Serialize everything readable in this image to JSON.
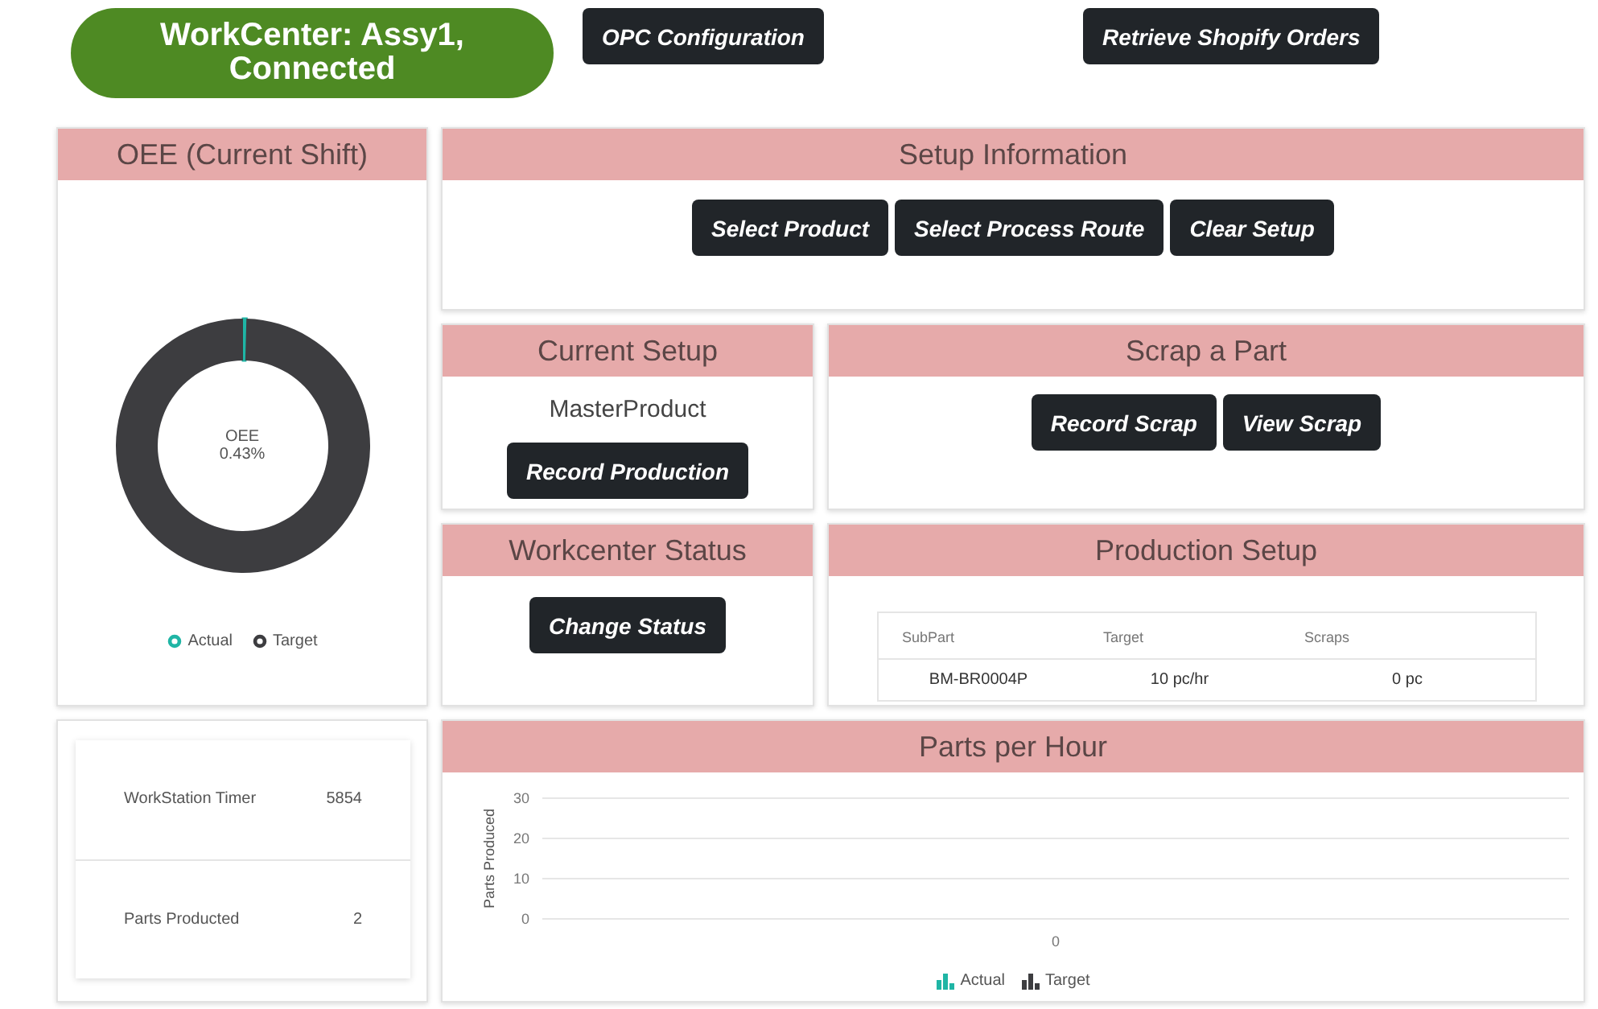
{
  "top_bar": {
    "workcenter_status": "WorkCenter: Assy1, Connected",
    "buttons": [
      "OPC Configuration",
      "Retrieve Shopify Orders"
    ]
  },
  "oee": {
    "title": "OEE (Current Shift)",
    "center_value": "0.43%",
    "chart_data": {
      "type": "donut",
      "categories": [
        "Actual",
        "Target"
      ],
      "series": [
        {
          "name": "OEE",
          "values": [
            0.43,
            99.57
          ]
        }
      ],
      "colors": [
        "#1fb5a5",
        "#3d3d40"
      ]
    }
  },
  "setup_information": {
    "title": "Setup Information",
    "buttons": [
      "Select Product",
      "Select Process Route",
      "Clear Setup"
    ]
  },
  "current_setup": {
    "title": "Current Setup",
    "product": "MasterProduct",
    "button": "Record Production"
  },
  "scrap": {
    "title": "Scrap a Part",
    "buttons": [
      "Record Scrap",
      "View Scrap"
    ]
  },
  "workcenter_status": {
    "title": "Workcenter Status",
    "button": "Change Status"
  },
  "production_setup": {
    "title": "Production Setup",
    "columns": [
      "SubPart",
      "Target",
      "Scraps"
    ],
    "rows": [
      [
        "BM-BR0004P",
        "10 pc/hr",
        "0 pc"
      ]
    ]
  },
  "stats": [
    {
      "label": "WorkStation Timer",
      "value": "5854"
    },
    {
      "label": "Parts Producted",
      "value": "2"
    }
  ],
  "parts_per_hour": {
    "title": "Parts per Hour",
    "chart_data": {
      "type": "bar",
      "ylabel": "Parts Produced",
      "categories": [
        "0"
      ],
      "series": [
        {
          "name": "Actual",
          "color": "#1fb5a5",
          "values": [
            0
          ]
        },
        {
          "name": "Target",
          "color": "#3d3d40",
          "values": [
            0
          ]
        }
      ],
      "ylim": [
        0,
        30
      ],
      "yticks": [
        0,
        10,
        20,
        30
      ]
    }
  }
}
